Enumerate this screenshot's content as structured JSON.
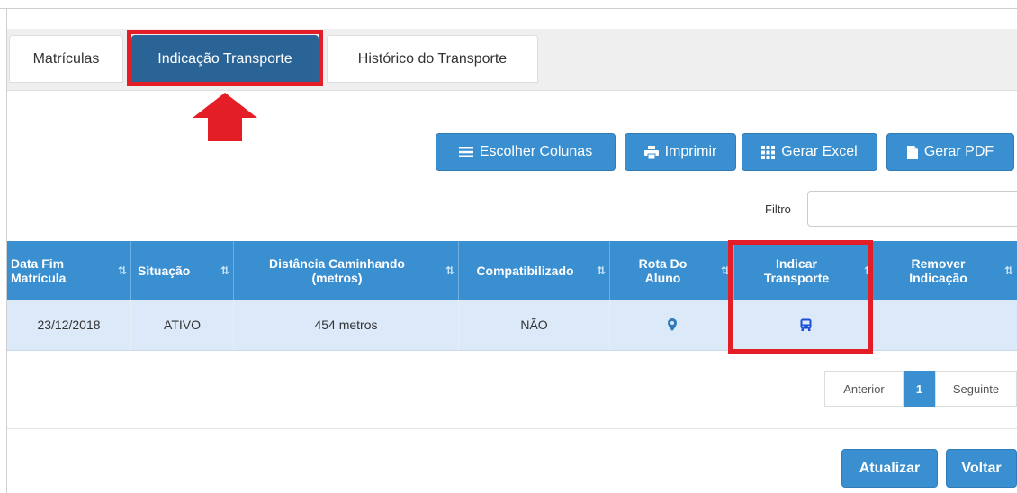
{
  "tabs": [
    {
      "label": "Matrículas",
      "active": false
    },
    {
      "label": "Indicação Transporte",
      "active": true
    },
    {
      "label": "Histórico do Transporte",
      "active": false
    }
  ],
  "toolbar": {
    "choose_columns": {
      "label": "Escolher Colunas",
      "icon": "list-icon"
    },
    "print": {
      "label": "Imprimir",
      "icon": "print-icon"
    },
    "excel": {
      "label": "Gerar Excel",
      "icon": "grid-icon"
    },
    "pdf": {
      "label": "Gerar PDF",
      "icon": "file-icon"
    }
  },
  "filter": {
    "label": "Filtro",
    "value": ""
  },
  "table": {
    "columns": [
      {
        "line1": "Data Fim",
        "line2": "Matrícula"
      },
      {
        "line1": "Situação",
        "line2": ""
      },
      {
        "line1": "Distância Caminhando",
        "line2": "(metros)"
      },
      {
        "line1": "Compatibilizado",
        "line2": ""
      },
      {
        "line1": "Rota Do",
        "line2": "Aluno"
      },
      {
        "line1": "Indicar",
        "line2": "Transporte"
      },
      {
        "line1": "Remover",
        "line2": "Indicação"
      }
    ],
    "sort_icon": "⇅",
    "rows": [
      {
        "data_fim": "23/12/2018",
        "situacao": "ATIVO",
        "distancia": "454 metros",
        "compatibilizado": "NÃO",
        "rota_icon": "map-marker-icon",
        "indicar_icon": "bus-icon",
        "remover": ""
      }
    ]
  },
  "pagination": {
    "previous": "Anterior",
    "current": "1",
    "next": "Seguinte"
  },
  "footer": {
    "refresh": "Atualizar",
    "back": "Voltar"
  },
  "colors": {
    "primary": "#3a8fd1",
    "tab_active": "#2a6496",
    "highlight": "#e41e26",
    "row_bg": "#dbe9f9"
  }
}
